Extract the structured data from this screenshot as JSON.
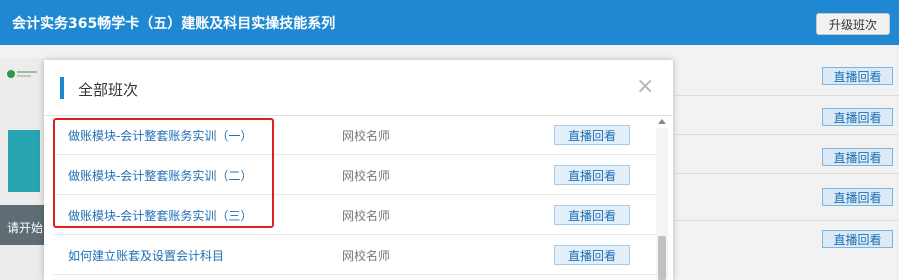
{
  "header": {
    "course_title": "会计实务365畅学卡（五）建账及科目实操技能系列",
    "upgrade_label": "升级班次"
  },
  "background": {
    "overlay_text": "请开始",
    "live_replay_label": "直播回看"
  },
  "modal": {
    "title": "全部班次",
    "close_symbol": "×",
    "rows": [
      {
        "title": "做账模块-会计整套账务实训（一）",
        "teacher": "网校名师",
        "action": "直播回看"
      },
      {
        "title": "做账模块-会计整套账务实训（二）",
        "teacher": "网校名师",
        "action": "直播回看"
      },
      {
        "title": "做账模块-会计整套账务实训（三）",
        "teacher": "网校名师",
        "action": "直播回看"
      },
      {
        "title": "如何建立账套及设置会计科目",
        "teacher": "网校名师",
        "action": "直播回看"
      }
    ]
  },
  "colors": {
    "header_blue": "#1e89d2",
    "link_blue": "#1e6fb5",
    "highlight_red": "#e02020"
  }
}
